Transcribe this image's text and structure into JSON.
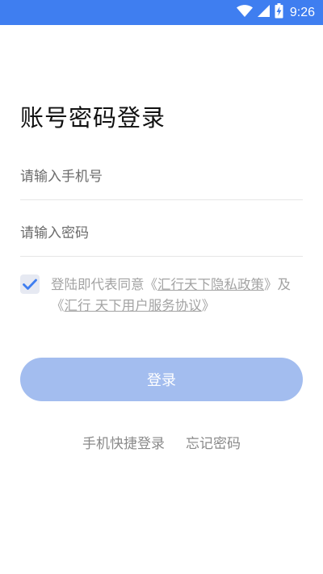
{
  "status_bar": {
    "time": "9:26",
    "icons": [
      "wifi-icon",
      "cellular-icon",
      "battery-charging-icon"
    ],
    "background": "#3f7ef0"
  },
  "page": {
    "title": "账号密码登录"
  },
  "form": {
    "phone_placeholder": "请输入手机号",
    "password_placeholder": "请输入密码"
  },
  "agreement": {
    "checked": true,
    "text_prefix": "登陆即代表同意《",
    "privacy_link": "汇行天下隐私政策",
    "text_middle": "》及《",
    "user_agreement_link": "汇行 天下用户服务协议",
    "text_suffix": "》",
    "checkbox_color": "#3f7ef0"
  },
  "login_button": {
    "label": "登录",
    "color": "#a3bdef"
  },
  "links": {
    "quick_login": "手机快捷登录",
    "forgot_password": "忘记密码"
  }
}
